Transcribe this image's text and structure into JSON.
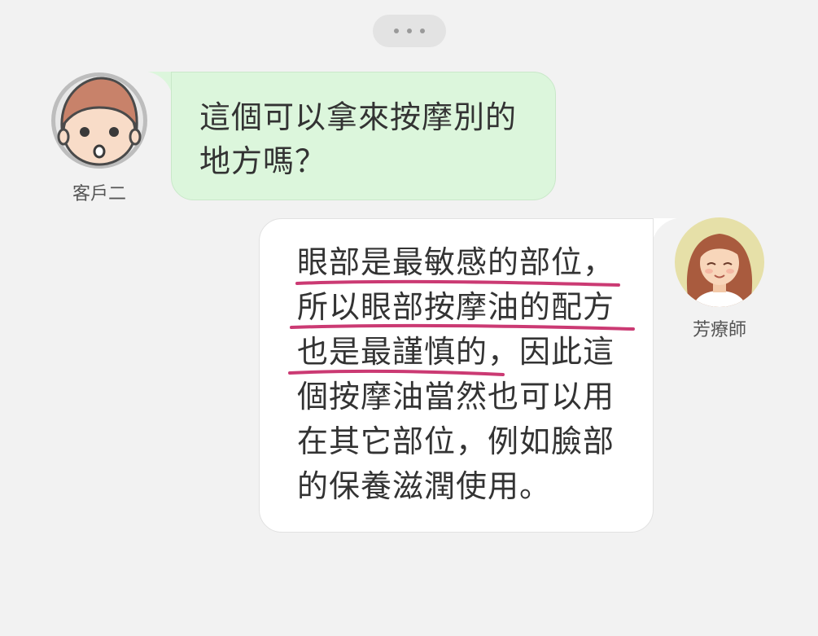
{
  "chat": {
    "typing_indicator": {
      "dots": 3
    },
    "customer": {
      "name": "客戶二",
      "avatar_icon": "boy-face-icon",
      "message_lines": [
        "這個可以拿來按摩別的",
        "地方嗎？"
      ]
    },
    "therapist": {
      "name": "芳療師",
      "avatar_icon": "woman-face-icon",
      "message_lines": [
        "眼部是最敏感的部位，",
        "所以眼部按摩油的配方",
        "也是最謹慎的，因此這",
        "個按摩油當然也可以用",
        "在其它部位，例如臉部",
        "的保養滋潤使用。"
      ],
      "highlighted_line_count": 3
    }
  },
  "colors": {
    "background": "#f2f2f2",
    "customer_bubble": "#dcf6dc",
    "therapist_bubble": "#ffffff",
    "highlight_underline": "#c2185b",
    "typing_pill": "#e3e3e3"
  }
}
